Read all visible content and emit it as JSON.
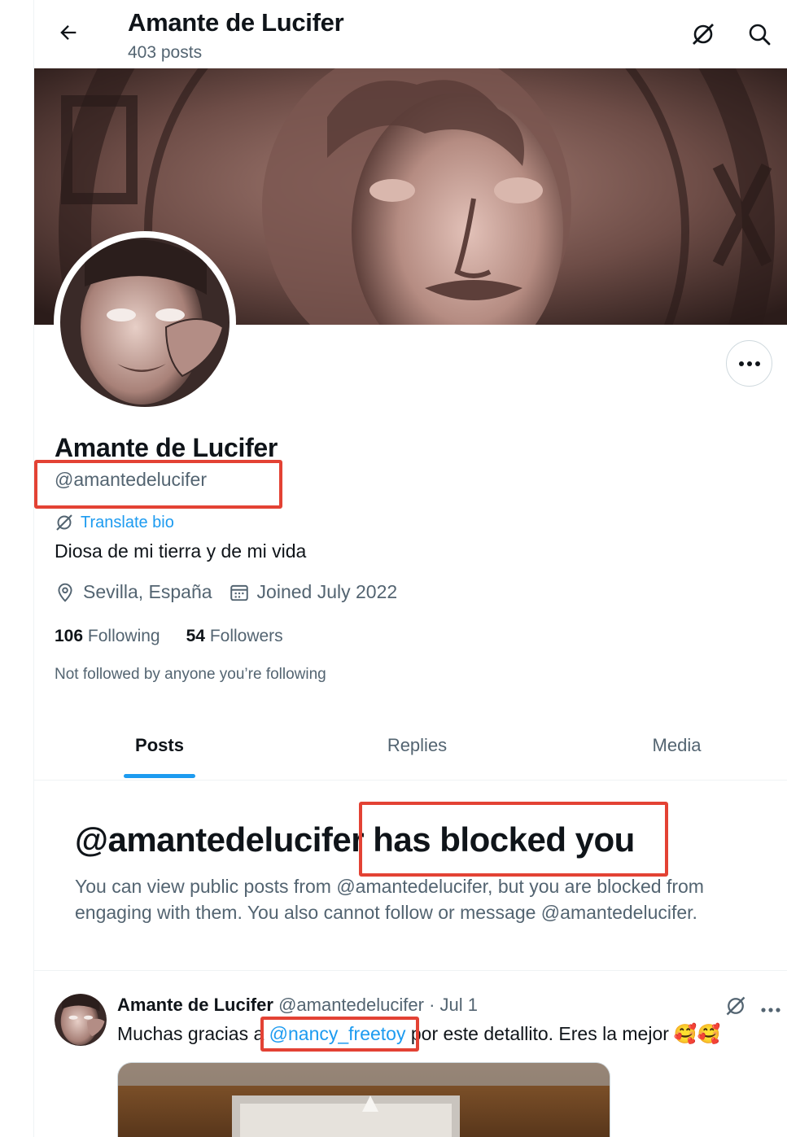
{
  "header": {
    "title": "Amante de Lucifer",
    "post_count": "403 posts",
    "back_icon": "arrow-left-icon",
    "grok_icon": "grok-icon",
    "search_icon": "search-icon"
  },
  "profile": {
    "name": "Amante de Lucifer",
    "handle": "@amantedelucifer",
    "translate_label": "Translate bio",
    "bio": "Diosa de mi tierra y de mi vida",
    "location": "Sevilla, España",
    "joined": "Joined July 2022",
    "following_count": "106",
    "following_label": "Following",
    "followers_count": "54",
    "followers_label": "Followers",
    "not_followed": "Not followed by anyone you’re following"
  },
  "tabs": [
    {
      "label": "Posts",
      "active": true
    },
    {
      "label": "Replies",
      "active": false
    },
    {
      "label": "Media",
      "active": false
    }
  ],
  "blocked": {
    "title": "@amantedelucifer has blocked you",
    "body": "You can view public posts from @amantedelucifer, but you are blocked from engaging with them. You also cannot follow or message @amantedelucifer."
  },
  "post": {
    "author_name": "Amante de Lucifer",
    "author_handle": "@amantedelucifer",
    "separator": "·",
    "date": "Jul 1",
    "text_before": "Muchas gracias a ",
    "mention": "@nancy_freetoy",
    "text_after": " por este detallito. Eres la mejor",
    "emoji": "🥰🥰"
  },
  "colors": {
    "accent": "#1d9bf0",
    "annotation_red": "#e34234",
    "secondary_text": "#536471",
    "primary_text": "#0f1419"
  }
}
